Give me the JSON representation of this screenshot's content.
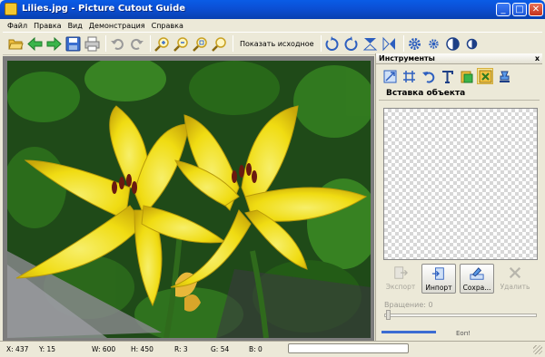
{
  "window": {
    "title": "Lilies.jpg - Picture Cutout Guide",
    "icon": "scissors-app-icon",
    "buttons": [
      "minimize",
      "maximize",
      "close"
    ]
  },
  "menu": {
    "items": [
      "Файл",
      "Правка",
      "Вид",
      "Демонстрация",
      "Справка"
    ]
  },
  "toolbar": {
    "show_original_label": "Показать исходное",
    "icons": [
      "open-folder-icon",
      "back-arrow-icon",
      "forward-arrow-icon",
      "save-icon",
      "print-icon",
      "undo-icon",
      "redo-icon",
      "zoom-in-icon",
      "zoom-out-icon",
      "zoom-fit-icon",
      "zoom-actual-icon",
      "rotate-ccw-icon",
      "rotate-cw-icon",
      "flip-vertical-icon",
      "flip-horizontal-icon",
      "settings-gear-icon",
      "settings-small-gear-icon",
      "contrast-icon",
      "contrast-small-icon"
    ]
  },
  "panel": {
    "title": "Инструменты",
    "close": "x",
    "section_title": "Вставка объекта",
    "tools": [
      "resize-icon",
      "crop-grid-icon",
      "undo-tool-icon",
      "text-tool-icon",
      "paste-object-icon",
      "insert-object-icon",
      "stamp-icon"
    ],
    "buttons": [
      {
        "label": "Экспорт",
        "enabled": false,
        "icon": "export-icon"
      },
      {
        "label": "Инпорт",
        "enabled": true,
        "icon": "import-icon"
      },
      {
        "label": "Сохра...",
        "enabled": true,
        "icon": "save-object-icon"
      },
      {
        "label": "Удалить",
        "enabled": false,
        "icon": "delete-x-icon"
      }
    ],
    "rotation_label": "Вращение: 0",
    "rotation_value": 0,
    "clipped_label": "Еоп!"
  },
  "status": {
    "x": "X: 437",
    "y": "Y: 15",
    "w": "W: 600",
    "h": "H: 450",
    "r": "R: 3",
    "g": "G: 54",
    "b": "B: 0",
    "progress": 0
  },
  "colors": {
    "titlebar": "#0b4fd4",
    "chrome": "#ece9d8",
    "lily": "#f2da10",
    "foliage": "#2f7a1e",
    "canvas_bg": "#7d7d7d"
  }
}
